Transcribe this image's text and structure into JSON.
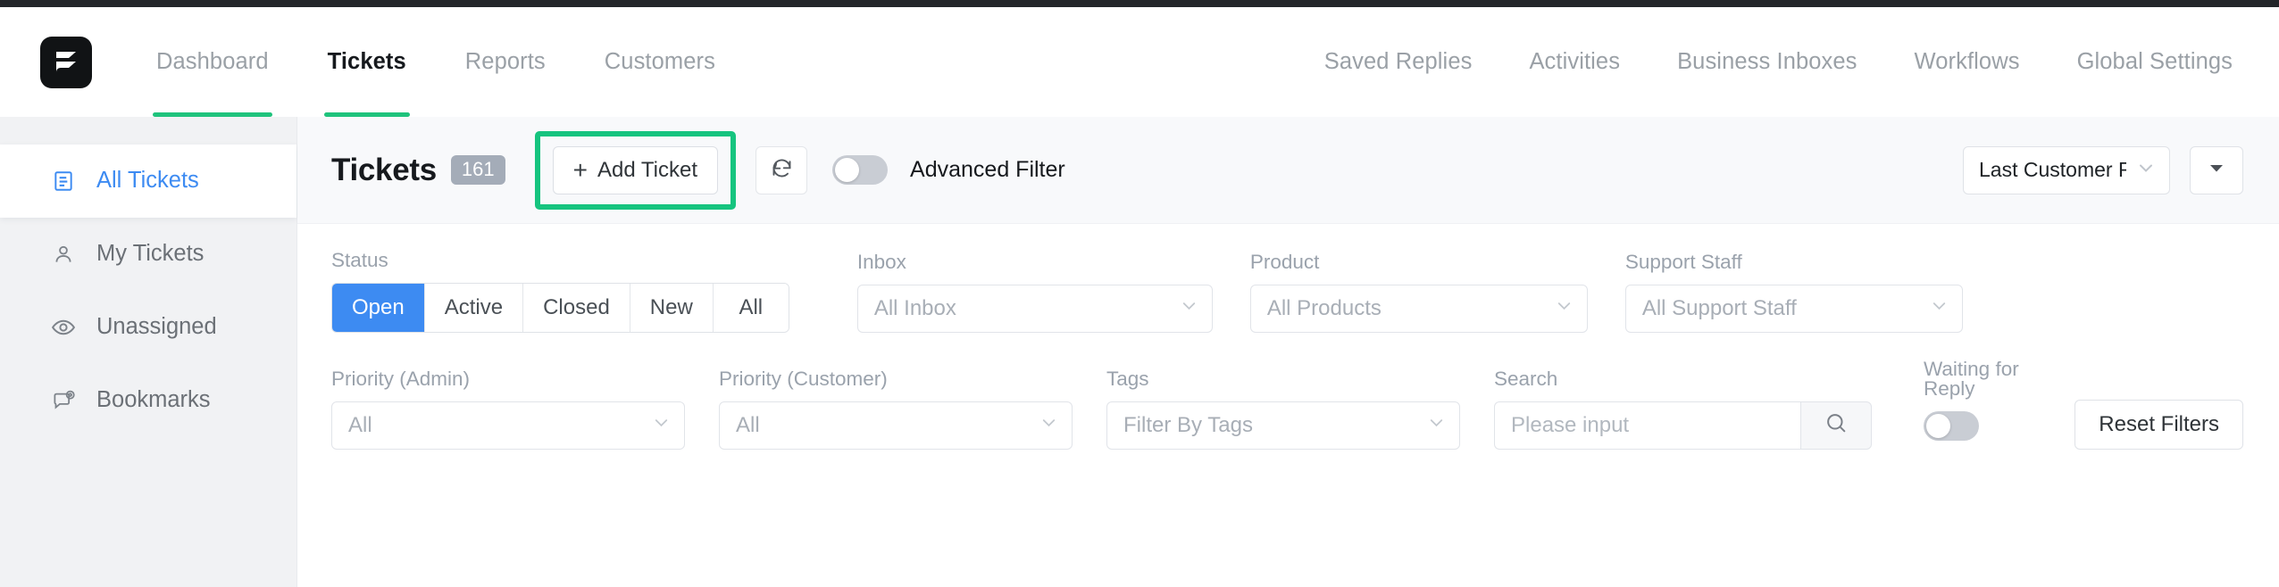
{
  "header": {
    "logo_icon": "flowdesk-logo-icon",
    "nav_left": [
      {
        "label": "Dashboard",
        "active": false
      },
      {
        "label": "Tickets",
        "active": true
      },
      {
        "label": "Reports",
        "active": false
      },
      {
        "label": "Customers",
        "active": false
      }
    ],
    "nav_right": [
      {
        "label": "Saved Replies"
      },
      {
        "label": "Activities"
      },
      {
        "label": "Business Inboxes"
      },
      {
        "label": "Workflows"
      },
      {
        "label": "Global Settings"
      }
    ]
  },
  "sidebar": {
    "items": [
      {
        "label": "All Tickets",
        "icon": "document-list-icon",
        "active": true
      },
      {
        "label": "My Tickets",
        "icon": "user-icon",
        "active": false
      },
      {
        "label": "Unassigned",
        "icon": "eye-icon",
        "active": false
      },
      {
        "label": "Bookmarks",
        "icon": "mention-bubble-icon",
        "active": false
      }
    ]
  },
  "title_bar": {
    "title": "Tickets",
    "count": "161",
    "add_ticket_label": "Add Ticket",
    "add_ticket_plus": "+",
    "refresh_icon": "refresh-icon",
    "advanced_filter_label": "Advanced Filter",
    "advanced_filter_on": false,
    "sort_select_value": "Last Customer Response",
    "sort_caret_icon": "chevron-down-icon",
    "extra_dropdown_icon": "caret-down-icon",
    "highlight_color": "#16c47f"
  },
  "filters": {
    "status": {
      "label": "Status",
      "options": [
        "Open",
        "Active",
        "Closed",
        "New",
        "All"
      ],
      "selected": "Open",
      "selected_color": "#3d8bf2"
    },
    "inbox": {
      "label": "Inbox",
      "value": "All Inbox"
    },
    "product": {
      "label": "Product",
      "value": "All Products"
    },
    "support_staff": {
      "label": "Support Staff",
      "value": "All Support Staff"
    },
    "priority_admin": {
      "label": "Priority (Admin)",
      "value": "All"
    },
    "priority_customer": {
      "label": "Priority (Customer)",
      "value": "All"
    },
    "tags": {
      "label": "Tags",
      "value": "Filter By Tags"
    },
    "search": {
      "label": "Search",
      "placeholder": "Please input",
      "value": "",
      "icon": "search-icon"
    },
    "waiting_for_reply": {
      "label": "Waiting for Reply",
      "on": false
    },
    "reset_label": "Reset Filters"
  }
}
